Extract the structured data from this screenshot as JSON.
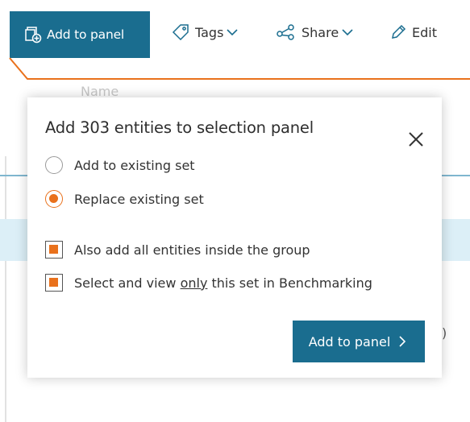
{
  "toolbar": {
    "add_to_panel_label": "Add to panel",
    "tags_label": "Tags",
    "share_label": "Share",
    "edit_label": "Edit",
    "icons": {
      "add_to_panel": "add-to-panel-icon",
      "tags": "tag-icon",
      "share": "share-icon",
      "edit": "pencil-icon",
      "dropdown": "chevron-down-icon"
    }
  },
  "background": {
    "column_header": "Name",
    "partial_text": ")"
  },
  "dialog": {
    "title": "Add 303 entities to selection panel",
    "options": [
      {
        "label": "Add to existing set",
        "selected": false
      },
      {
        "label": "Replace existing set",
        "selected": true
      }
    ],
    "checkboxes": [
      {
        "label": "Also add all entities inside the group",
        "checked": true
      },
      {
        "label_before": "Select and view ",
        "label_emphasis": "only",
        "label_after": " this set in Benchmarking",
        "checked": true
      }
    ],
    "submit_label": "Add to panel",
    "close_icon": "close-icon",
    "submit_icon": "chevron-right-icon"
  },
  "colors": {
    "primary": "#1a6d8f",
    "accent": "#e9711c",
    "highlight_band": "#dceff7",
    "divider": "#7fb6cf"
  }
}
